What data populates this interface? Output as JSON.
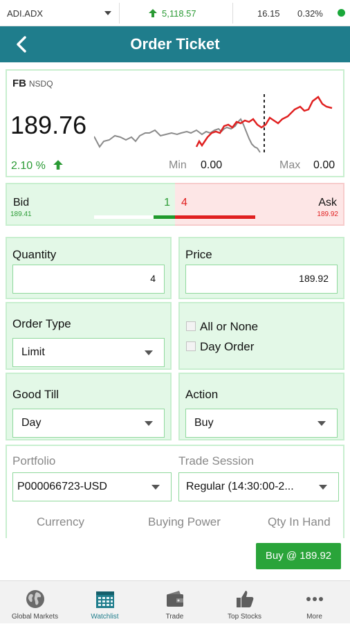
{
  "ticker": {
    "symbol": "ADI.ADX",
    "index_value": "5,118.57",
    "change": "16.15",
    "change_pct": "0.32%",
    "up_color": "#2a9a34"
  },
  "header": {
    "title": "Order Ticket",
    "back_icon": "back-arrow-icon",
    "bg_color": "#1f7d8c"
  },
  "quote": {
    "symbol": "FB",
    "exchange": "NSDQ",
    "last_price": "189.76",
    "change_pct": "2.10 %",
    "min_label": "Min",
    "min_value": "0.00",
    "max_label": "Max",
    "max_value": "0.00"
  },
  "depth": {
    "bid_label": "Bid",
    "bid_price": "189.41",
    "bid_size": "1",
    "ask_label": "Ask",
    "ask_price": "189.92",
    "ask_size": "4",
    "bid_color": "#2a9a34",
    "ask_color": "#e02020"
  },
  "form": {
    "quantity_label": "Quantity",
    "quantity_value": "4",
    "price_label": "Price",
    "price_value": "189.92",
    "order_type_label": "Order Type",
    "order_type_value": "Limit",
    "all_or_none_label": "All or None",
    "day_order_label": "Day Order",
    "good_till_label": "Good Till",
    "good_till_value": "Day",
    "action_label": "Action",
    "action_value": "Buy",
    "portfolio_label": "Portfolio",
    "portfolio_value": "P000066723-USD",
    "trade_session_label": "Trade Session",
    "trade_session_value": "Regular (14:30:00-2...",
    "currency_label": "Currency",
    "buying_power_label": "Buying Power",
    "qty_in_hand_label": "Qty In Hand"
  },
  "buy_button": {
    "label": "Buy @ 189.92",
    "color": "#2aa43a"
  },
  "nav": {
    "items": [
      {
        "label": "Global Markets",
        "icon": "globe-icon"
      },
      {
        "label": "Watchlist",
        "icon": "calendar-grid-icon"
      },
      {
        "label": "Trade",
        "icon": "wallet-icon"
      },
      {
        "label": "Top Stocks",
        "icon": "thumbs-up-icon"
      },
      {
        "label": "More",
        "icon": "more-dots-icon"
      }
    ],
    "active_index": 1,
    "active_color": "#1f7d8c"
  }
}
